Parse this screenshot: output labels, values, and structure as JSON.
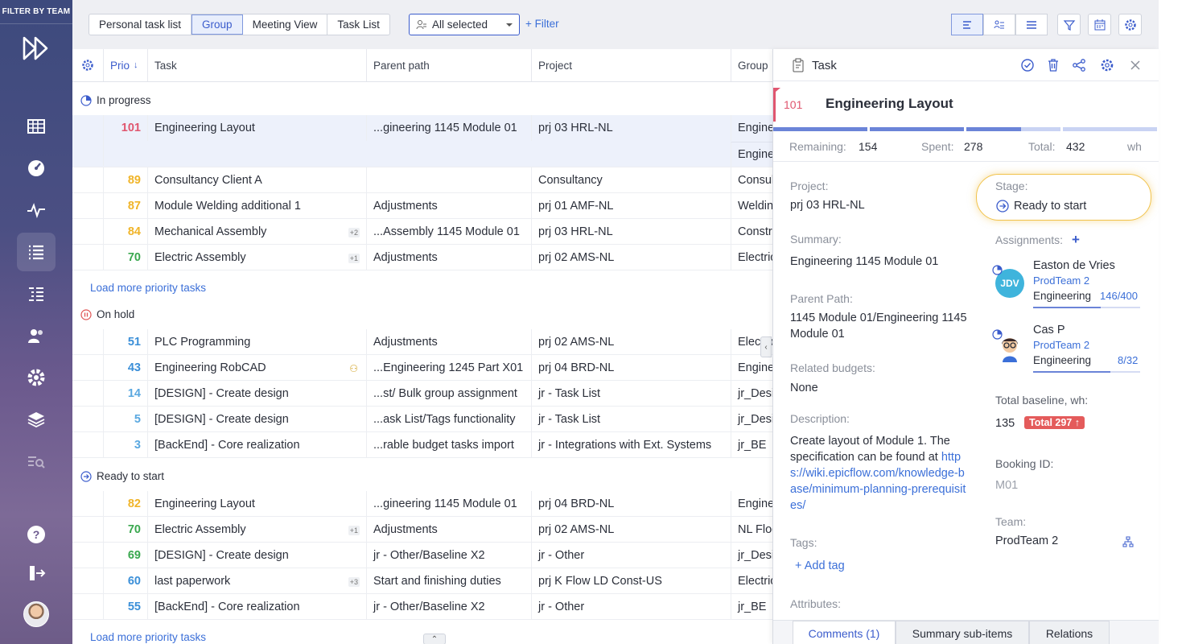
{
  "sidebar": {
    "filter_label": "FILTER BY TEAM",
    "items": [
      {
        "icon": "grid-icon"
      },
      {
        "icon": "dashboard-icon"
      },
      {
        "icon": "pulse-icon"
      },
      {
        "icon": "task-list-icon"
      },
      {
        "icon": "hierarchy-list-icon"
      },
      {
        "icon": "users-icon"
      },
      {
        "icon": "settings-icon"
      },
      {
        "icon": "layers-icon"
      },
      {
        "icon": "analytics-icon"
      }
    ]
  },
  "toolbar": {
    "view_tabs": [
      "Personal task list",
      "Group",
      "Meeting View",
      "Task List"
    ],
    "selected_view": "Group",
    "team_select": "All selected",
    "filter_label": "Filter"
  },
  "table": {
    "columns": [
      "Prio",
      "Task",
      "Parent path",
      "Project",
      "Group"
    ],
    "groups": [
      {
        "name": "In progress",
        "load_more": "Load more priority tasks",
        "rows": [
          {
            "prio": "101",
            "task": "Engineering Layout",
            "parent": "...gineering 1145 Module 01",
            "project": "prj 03 HRL-NL",
            "group": "Engineering",
            "group2": "Engineering",
            "color": "#e0566f"
          },
          {
            "prio": "89",
            "task": "Consultancy Client A",
            "parent": "",
            "project": "Consultancy",
            "group": "Consultancy",
            "color": "#f0b428"
          },
          {
            "prio": "87",
            "task": "Module Welding additional 1",
            "parent": "Adjustments",
            "project": "prj 01 AMF-NL",
            "group": "Welding",
            "color": "#f0b428"
          },
          {
            "prio": "84",
            "task": "Mechanical Assembly",
            "badge": "+2",
            "parent": "...Assembly 1145 Module 01",
            "project": "prj 03 HRL-NL",
            "group": "Construction",
            "color": "#f0b428"
          },
          {
            "prio": "70",
            "task": "Electric Assembly",
            "badge": "+1",
            "parent": "Adjustments",
            "project": "prj 02 AMS-NL",
            "group": "Electric",
            "color": "#3aa84f"
          }
        ]
      },
      {
        "name": "On hold",
        "rows": [
          {
            "prio": "51",
            "task": "PLC Programming",
            "parent": "Adjustments",
            "project": "prj 02 AMS-NL",
            "group": "Electric",
            "color": "#3b8fd8"
          },
          {
            "prio": "43",
            "task": "Engineering RobCAD",
            "parent": "...Engineering 1245 Part X01",
            "project": "prj 04 BRD-NL",
            "group": "Engineering",
            "color": "#3b8fd8"
          },
          {
            "prio": "14",
            "task": "[DESIGN] - Create design",
            "parent": "...st/ Bulk group assignment",
            "project": "jr - Task List",
            "group": "jr_Design",
            "color": "#5aa8e0"
          },
          {
            "prio": "5",
            "task": "[DESIGN] - Create design",
            "parent": "...ask List/Tags functionality",
            "project": "jr - Task List",
            "group": "jr_Design",
            "color": "#5aa8e0"
          },
          {
            "prio": "3",
            "task": "[BackEnd] - Core realization",
            "parent": "...rable budget tasks import",
            "project": "jr - Integrations with Ext. Systems",
            "group": "jr_BE",
            "color": "#5aa8e0"
          }
        ]
      },
      {
        "name": "Ready to start",
        "load_more": "Load more priority tasks",
        "rows": [
          {
            "prio": "82",
            "task": "Engineering Layout",
            "parent": "...gineering 1145 Module 01",
            "project": "prj 04 BRD-NL",
            "group": "Engineering",
            "color": "#f0b428"
          },
          {
            "prio": "70",
            "task": "Electric Assembly",
            "badge": "+1",
            "parent": "Adjustments",
            "project": "prj 02 AMS-NL",
            "group": "NL Floor",
            "color": "#3aa84f"
          },
          {
            "prio": "69",
            "task": "[DESIGN] - Create design",
            "parent": "jr - Other/Baseline X2",
            "project": "jr - Other",
            "group": "jr_Design",
            "color": "#3aa84f"
          },
          {
            "prio": "60",
            "task": "last paperwork",
            "badge": "+3",
            "parent": "Start and finishing duties",
            "project": "prj K Flow LD Const-US",
            "group": "Electric",
            "color": "#3b8fd8"
          },
          {
            "prio": "55",
            "task": "[BackEnd] - Core realization",
            "parent": "jr - Other/Baseline X2",
            "project": "jr - Other",
            "group": "jr_BE",
            "color": "#3b8fd8"
          }
        ]
      }
    ]
  },
  "panel": {
    "header": "Task",
    "task_number": "101",
    "task_title": "Engineering Layout",
    "remaining_label": "Remaining:",
    "remaining": "154",
    "spent_label": "Spent:",
    "spent": "278",
    "total_label": "Total:",
    "total": "432",
    "unit": "wh",
    "project_label": "Project:",
    "project": "prj 03 HRL-NL",
    "summary_label": "Summary:",
    "summary": "Engineering 1145 Module 01",
    "parent_path_label": "Parent Path:",
    "parent_path": "1145 Module 01/Engineering 1145 Module 01",
    "budgets_label": "Related budgets:",
    "budgets": "None",
    "description_label": "Description:",
    "description": "Create layout of Module 1. The specification can be found at",
    "description_link": "https://wiki.epicflow.com/knowledge-base/minimum-planning-prerequisites/",
    "tags_label": "Tags:",
    "add_tag": "Add tag",
    "attributes_label": "Attributes:",
    "stage_label": "Stage:",
    "stage": "Ready to start",
    "assignments_label": "Assignments:",
    "assignees": [
      {
        "initials": "JDV",
        "name": "Easton de Vries",
        "team": "ProdTeam 2",
        "group": "Engineering",
        "hours": "146/400",
        "progress": 0.8
      },
      {
        "initials": "",
        "name": "Cas P",
        "team": "ProdTeam 2",
        "group": "Engineering",
        "hours": "8/32",
        "progress": 0.7
      }
    ],
    "baseline_label": "Total baseline, wh:",
    "baseline": "135",
    "baseline_badge": "Total 297 ↑",
    "booking_label": "Booking ID:",
    "booking": "M01",
    "team_label": "Team:",
    "team": "ProdTeam 2",
    "tabs": [
      "Comments (1)",
      "Summary sub-items",
      "Relations"
    ]
  }
}
